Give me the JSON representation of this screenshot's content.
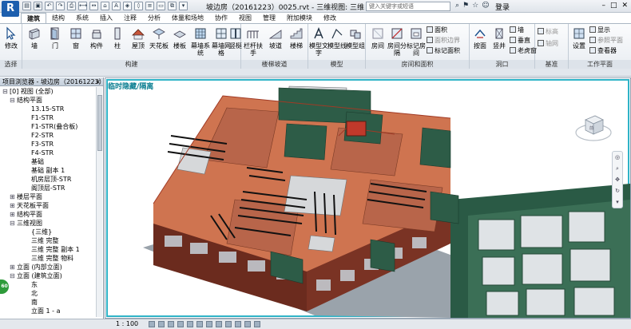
{
  "app": {
    "logo": "R",
    "title": "坡边房（20161223）0025.rvt - 三维视图: 三维",
    "search_placeholder": "键入关键字或短语",
    "login_label": "登录",
    "window_buttons": [
      "–",
      "□",
      "✕"
    ]
  },
  "tabs": [
    "建筑",
    "结构",
    "系统",
    "插入",
    "注释",
    "分析",
    "体量和场地",
    "协作",
    "视图",
    "管理",
    "附加模块",
    "修改"
  ],
  "ribbon": {
    "groups": {
      "select": "选择",
      "build": "构建",
      "circulation": "楼梯坡道",
      "model": "模型",
      "room": "房间和面积",
      "opening": "洞口",
      "datum": "基准",
      "workplane": "工作平面"
    },
    "buttons": {
      "modify": "修改",
      "wall": "墙",
      "door": "门",
      "window": "窗",
      "component": "构件",
      "column": "柱",
      "roof": "屋顶",
      "ceiling": "天花板",
      "floor": "楼板",
      "curtain_system": "幕墙系统",
      "curtain_grid": "幕墙网格",
      "mullion": "竖梃",
      "railing": "栏杆扶手",
      "ramp": "坡道",
      "stair": "楼梯",
      "model_text": "模型文字",
      "model_line": "模型线",
      "model_group": "模型组",
      "room": "房间",
      "room_separator": "房间分隔",
      "tag_room": "标记房间",
      "area": "面积",
      "area_boundary": "面积边界",
      "tag_area": "标记面积",
      "by_face": "按面",
      "shaft": "竖井",
      "wall_opening": "墙",
      "vertical": "垂直",
      "dormer": "老虎窗",
      "level": "标高",
      "grid": "轴网",
      "set": "设置",
      "show": "显示",
      "ref_plane": "参照平面",
      "viewer": "查看器"
    }
  },
  "browser": {
    "title": "项目浏览器 - 坡边房（20161223）",
    "close": "×",
    "items": [
      {
        "indent": 0,
        "toggle": "⊟",
        "label": "[0] 视图 (全部)"
      },
      {
        "indent": 1,
        "toggle": "⊟",
        "label": "结构平面"
      },
      {
        "indent": 3,
        "toggle": "",
        "label": "13.15-STR"
      },
      {
        "indent": 3,
        "toggle": "",
        "label": "F1-STR"
      },
      {
        "indent": 3,
        "toggle": "",
        "label": "F1-STR(叠合板)"
      },
      {
        "indent": 3,
        "toggle": "",
        "label": "F2-STR"
      },
      {
        "indent": 3,
        "toggle": "",
        "label": "F3-STR"
      },
      {
        "indent": 3,
        "toggle": "",
        "label": "F4-STR"
      },
      {
        "indent": 3,
        "toggle": "",
        "label": "基础"
      },
      {
        "indent": 3,
        "toggle": "",
        "label": "基础 副本 1"
      },
      {
        "indent": 3,
        "toggle": "",
        "label": "机房层顶-STR"
      },
      {
        "indent": 3,
        "toggle": "",
        "label": "阁顶层-STR"
      },
      {
        "indent": 1,
        "toggle": "⊞",
        "label": "楼层平面"
      },
      {
        "indent": 1,
        "toggle": "⊞",
        "label": "天花板平面"
      },
      {
        "indent": 1,
        "toggle": "⊞",
        "label": "结构平面"
      },
      {
        "indent": 1,
        "toggle": "⊟",
        "label": "三维视图"
      },
      {
        "indent": 3,
        "toggle": "",
        "label": "{三维}"
      },
      {
        "indent": 3,
        "toggle": "",
        "label": "三维 完整"
      },
      {
        "indent": 3,
        "toggle": "",
        "label": "三维 完整 副本 1"
      },
      {
        "indent": 3,
        "toggle": "",
        "label": "三维 完整 物料"
      },
      {
        "indent": 1,
        "toggle": "⊞",
        "label": "立面 (内部立面)"
      },
      {
        "indent": 1,
        "toggle": "⊟",
        "label": "立面 (建筑立面)"
      },
      {
        "indent": 3,
        "toggle": "",
        "label": "东"
      },
      {
        "indent": 3,
        "toggle": "",
        "label": "北"
      },
      {
        "indent": 3,
        "toggle": "",
        "label": "南"
      },
      {
        "indent": 3,
        "toggle": "",
        "label": "立面 1 - a"
      }
    ]
  },
  "viewport": {
    "label": "临时隐藏/隔离",
    "viewcube": "前"
  },
  "status": {
    "scale": "1 : 100"
  },
  "colors": {
    "accent": "#2fb3c7",
    "brick": "#d9815a",
    "green": "#2f5e48",
    "teal": "#0b7e91"
  }
}
